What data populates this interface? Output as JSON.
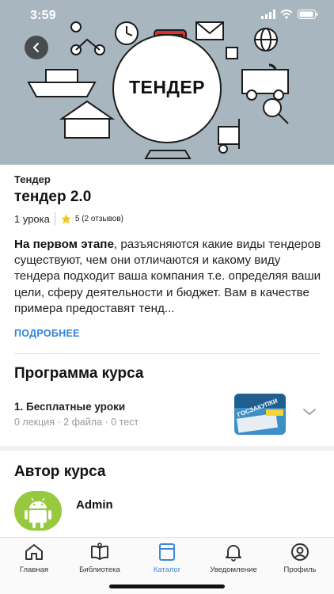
{
  "status_bar": {
    "time": "3:59"
  },
  "banner": {
    "text": "ТЕНДЕР"
  },
  "course": {
    "category": "Тендер",
    "title": "тендер 2.0",
    "lessons": "1 урока",
    "rating": "5 (2 отзывов)",
    "description_bold": "На первом этапе",
    "description_rest": ", разъясняются какие виды тендеров существуют, чем они отличаются и какому виду тендера подходит ваша компания т.е. определяя ваши цели, сферу деятельности и бюджет. Вам в качестве примера предоставят тенд...",
    "more_label": "ПОДРОБНЕЕ"
  },
  "program": {
    "heading": "Программа курса",
    "sections": [
      {
        "title": "1. Бесплатные уроки",
        "stats": "0 лекция · 2 файла · 0 тест",
        "thumb_text": "ГОСЗАКУПКИ"
      }
    ]
  },
  "author": {
    "heading": "Автор курса",
    "name": "Admin",
    "avatar_icon": "android-icon"
  },
  "tabbar": {
    "tabs": [
      {
        "label": "Главная",
        "icon": "home-icon"
      },
      {
        "label": "Библиотека",
        "icon": "book-icon"
      },
      {
        "label": "Каталог",
        "icon": "catalog-icon",
        "active": true
      },
      {
        "label": "Уведомление",
        "icon": "bell-icon"
      },
      {
        "label": "Профиль",
        "icon": "profile-icon"
      }
    ]
  },
  "colors": {
    "accent": "#3a8ad6",
    "link": "#2f82d6",
    "banner_bg": "#a8b6bf",
    "avatar_bg": "#96c93d"
  }
}
